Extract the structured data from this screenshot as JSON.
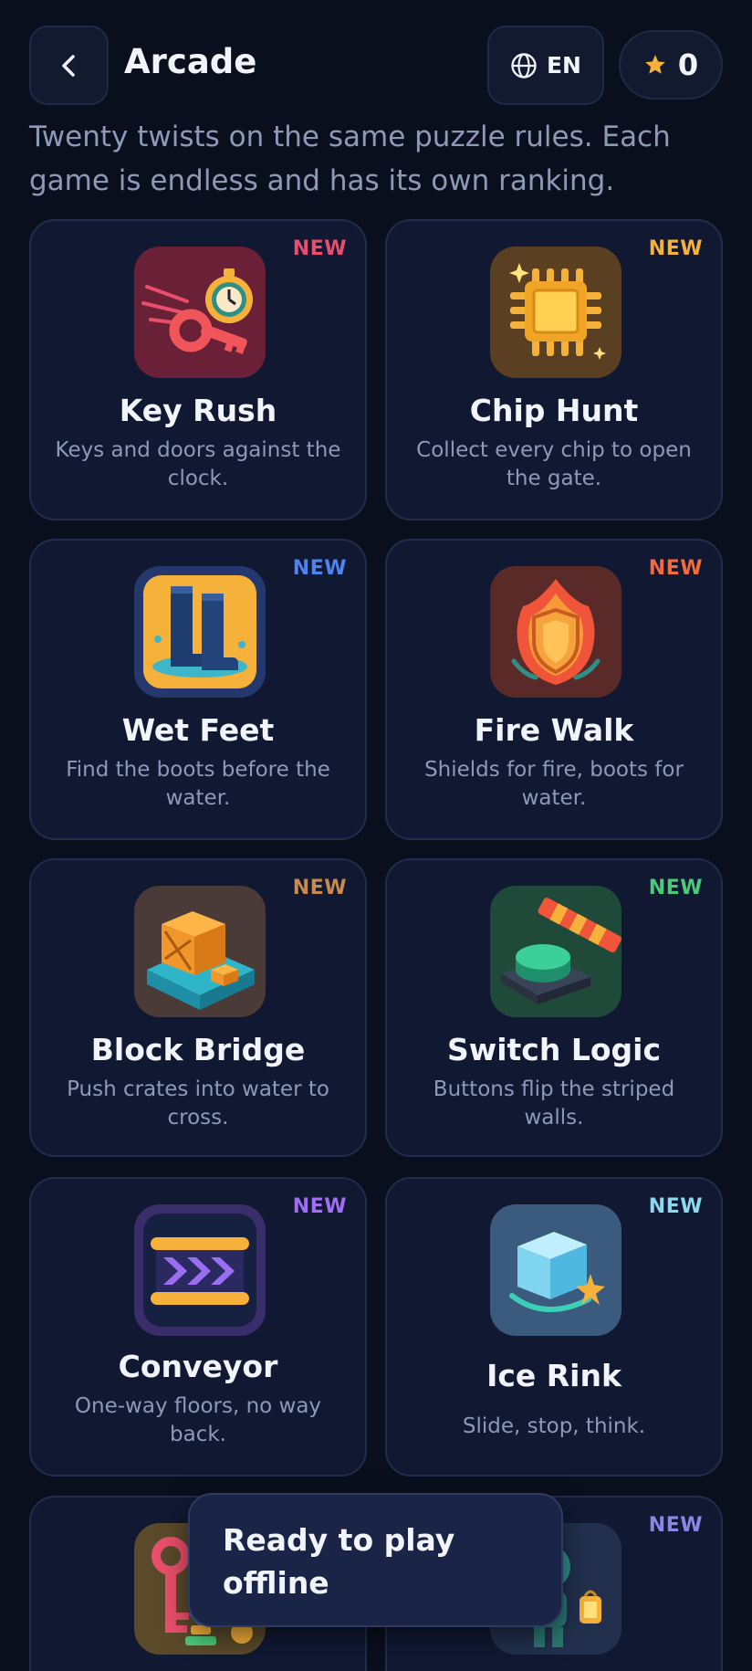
{
  "header": {
    "title": "Arcade",
    "language": "EN",
    "stars": "0"
  },
  "subtitle": "Twenty twists on the same puzzle rules. Each game is endless and has its own ranking.",
  "colors": {
    "background": "#0a0f1d",
    "card": "#111832",
    "card_border": "#222c4c",
    "muted_text": "#8d99b7",
    "star": "#f5b13a"
  },
  "games": [
    {
      "name": "Key Rush",
      "description": "Keys and doors against the clock.",
      "badge": "NEW",
      "badge_color": "#e94f6c",
      "icon": "key-stopwatch-icon"
    },
    {
      "name": "Chip Hunt",
      "description": "Collect every chip to open the gate.",
      "badge": "NEW",
      "badge_color": "#f5b13a",
      "icon": "microchip-icon"
    },
    {
      "name": "Wet Feet",
      "description": "Find the boots before the water.",
      "badge": "NEW",
      "badge_color": "#4f84f0",
      "icon": "boots-icon"
    },
    {
      "name": "Fire Walk",
      "description": "Shields for fire, boots for water.",
      "badge": "NEW",
      "badge_color": "#f26a3d",
      "icon": "fire-shield-icon"
    },
    {
      "name": "Block Bridge",
      "description": "Push crates into water to cross.",
      "badge": "NEW",
      "badge_color": "#c98a4b",
      "icon": "crate-water-icon"
    },
    {
      "name": "Switch Logic",
      "description": "Buttons flip the striped walls.",
      "badge": "NEW",
      "badge_color": "#4cc97a",
      "icon": "button-barrier-icon"
    },
    {
      "name": "Conveyor",
      "description": "One-way floors, no way back.",
      "badge": "NEW",
      "badge_color": "#a06ef2",
      "icon": "conveyor-belt-icon"
    },
    {
      "name": "Ice Rink",
      "description": "Slide, stop, think.",
      "badge": "NEW",
      "badge_color": "#8ed8f0",
      "icon": "ice-cube-icon"
    },
    {
      "name": "",
      "description": "",
      "badge": "",
      "badge_color": "#8a86e6",
      "icon": "keys-icon"
    },
    {
      "name": "",
      "description": "",
      "badge": "NEW",
      "badge_color": "#8a86e6",
      "icon": "robot-lantern-icon"
    }
  ],
  "toast": "Ready to play offline"
}
